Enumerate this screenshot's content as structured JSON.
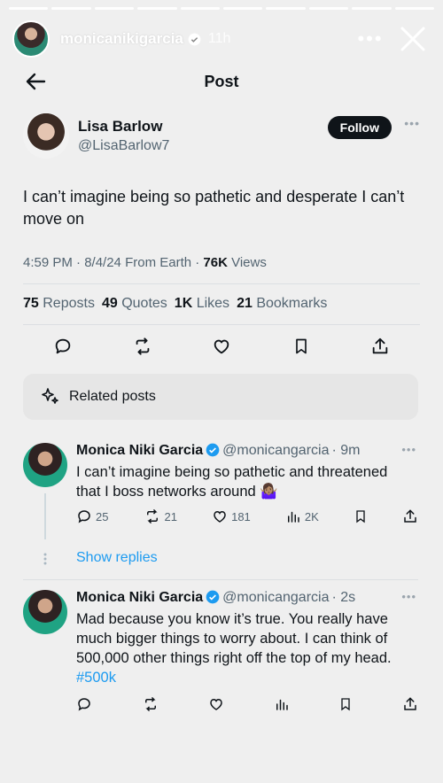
{
  "story": {
    "username": "monicanikigarcia",
    "time": "11h",
    "more": "•••"
  },
  "post_header": {
    "title": "Post"
  },
  "author": {
    "name": "Lisa Barlow",
    "handle": "@LisaBarlow7",
    "follow_label": "Follow",
    "more": "•••"
  },
  "tweet": {
    "text": "I can’t imagine being so pathetic and desperate I can’t move on",
    "time": "4:59 PM · 8/4/24 From Earth · ",
    "views_count": "76K",
    "views_label": " Views"
  },
  "stats": {
    "reposts_count": "75",
    "reposts_label": "Reposts",
    "quotes_count": "49",
    "quotes_label": "Quotes",
    "likes_count": "1K",
    "likes_label": "Likes",
    "bookmarks_count": "21",
    "bookmarks_label": "Bookmarks"
  },
  "related": {
    "label": "Related posts"
  },
  "replies": [
    {
      "name": "Monica Niki Garcia",
      "handle": "@monicangarcia",
      "time": "· 9m",
      "text": "I can’t imagine being so pathetic and threatened that I boss networks around 🤷🏽‍♀️",
      "reply_count": "25",
      "repost_count": "21",
      "like_count": "181",
      "view_count": "2K"
    },
    {
      "name": "Monica Niki Garcia",
      "handle": "@monicangarcia",
      "time": "· 2s",
      "text": "Mad because you know it’s true. You really have much bigger things to worry about. I can think of 500,000 other things right off the top of my head.",
      "hashtag": "#500k"
    }
  ],
  "show_replies": "Show replies",
  "colors": {
    "accent": "#1d9bf0",
    "text": "#0f1419",
    "muted": "#536471",
    "background": "#efefef"
  }
}
